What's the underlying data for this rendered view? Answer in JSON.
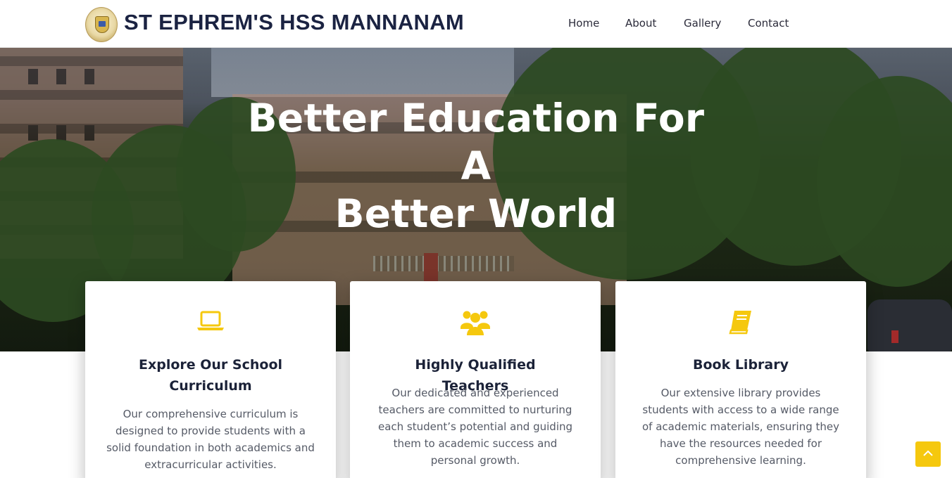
{
  "header": {
    "school_name": "ST EPHREM'S HSS MANNANAM",
    "logo_icon": "school-crest-icon",
    "nav": [
      {
        "label": "Home"
      },
      {
        "label": "About"
      },
      {
        "label": "Gallery"
      },
      {
        "label": "Contact"
      }
    ]
  },
  "hero": {
    "title_line1": "Better Education For A",
    "title_line2": "Better World"
  },
  "features": [
    {
      "icon": "laptop-icon",
      "title": "Explore Our School Curriculum",
      "text": "Our comprehensive curriculum is designed to provide students with a solid foundation in both academics and extracurricular activities."
    },
    {
      "icon": "users-icon",
      "title": "Highly Qualified Teachers",
      "text": "Our dedicated and experienced teachers are committed to nurturing each student’s potential and guiding them to academic success and personal growth."
    },
    {
      "icon": "book-icon",
      "title": "Book Library",
      "text": "Our extensive library provides students with access to a wide range of academic materials, ensuring they have the resources needed for comprehensive learning."
    }
  ],
  "back_to_top_icon": "chevron-up-icon",
  "colors": {
    "accent": "#f5c80e",
    "heading": "#1b2238",
    "body_text": "#555a66"
  }
}
